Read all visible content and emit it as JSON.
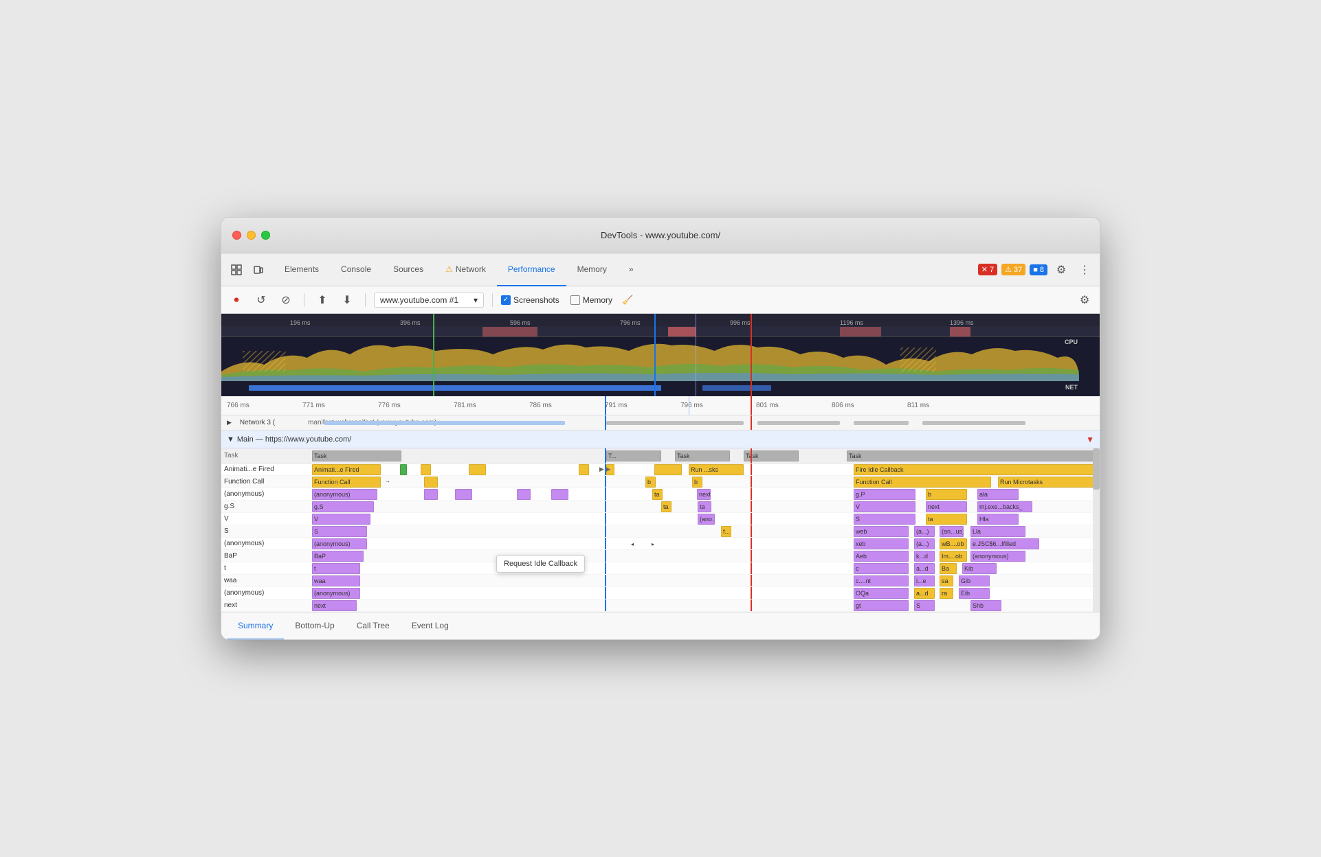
{
  "window": {
    "title": "DevTools - www.youtube.com/"
  },
  "tabs": {
    "items": [
      {
        "label": "Elements",
        "active": false,
        "warn": false
      },
      {
        "label": "Console",
        "active": false,
        "warn": false
      },
      {
        "label": "Sources",
        "active": false,
        "warn": false
      },
      {
        "label": "Network",
        "active": false,
        "warn": true
      },
      {
        "label": "Performance",
        "active": true,
        "warn": false
      },
      {
        "label": "Memory",
        "active": false,
        "warn": false
      }
    ],
    "more": "»",
    "badges": {
      "error": {
        "icon": "✕",
        "count": "7"
      },
      "warn": {
        "icon": "⚠",
        "count": "37"
      },
      "blue": {
        "icon": "■",
        "count": "8"
      }
    }
  },
  "toolbar": {
    "record": "⏺",
    "reload": "↺",
    "clear": "⊘",
    "upload": "⬆",
    "download": "⬇",
    "url": "www.youtube.com #1",
    "screenshots_label": "Screenshots",
    "memory_label": "Memory",
    "clean_icon": "🧹"
  },
  "ruler": {
    "ticks": [
      "196 ms",
      "396 ms",
      "596 ms",
      "796 ms",
      "996 ms",
      "1196 ms",
      "1396 ms"
    ]
  },
  "zoom_ruler": {
    "ticks": [
      "766 ms",
      "771 ms",
      "776 ms",
      "781 ms",
      "786 ms",
      "791 ms",
      "796 ms",
      "801 ms",
      "806 ms",
      "811 ms"
    ]
  },
  "network_row": {
    "label": "Network 3 (",
    "detail": "manifest.webmanifest (www.youtube.com)"
  },
  "main_section": {
    "label": "Main — https://www.youtube.com/",
    "expanded": true
  },
  "flame_tasks": {
    "header_tasks": [
      "Task",
      "T...",
      "Task",
      "Task",
      "Task"
    ],
    "rows": [
      {
        "label": "Animati...e Fired",
        "color": "c-yellow"
      },
      {
        "label": "Function Call",
        "color": "c-yellow"
      },
      {
        "label": "(anonymous)",
        "color": "c-purple"
      },
      {
        "label": "g.S",
        "color": "c-purple"
      },
      {
        "label": "V",
        "color": "c-purple"
      },
      {
        "label": "S",
        "color": "c-purple"
      },
      {
        "label": "(anonymous)",
        "color": "c-purple"
      },
      {
        "label": "BaP",
        "color": "c-purple"
      },
      {
        "label": "t",
        "color": "c-purple"
      },
      {
        "label": "waa",
        "color": "c-purple"
      },
      {
        "label": "(anonymous)",
        "color": "c-purple"
      },
      {
        "label": "next",
        "color": "c-purple"
      }
    ],
    "mid_col": {
      "blocks": [
        "b",
        "ta",
        "Run ...sks",
        "b",
        "next",
        "ta",
        "(ano...us)",
        "f..."
      ]
    },
    "right_col": {
      "title": "Fire Idle Callback",
      "blocks": [
        {
          "label": "Function Call",
          "sub": [
            "g.P",
            "V",
            "S",
            "web",
            "xeb",
            "Aeb",
            "c",
            "c....nt",
            "OQa",
            "gt"
          ]
        },
        {
          "label": "Run Microtasks",
          "sub": [
            "b",
            "next",
            "ta",
            "(a...)",
            "(a...)",
            "k...d",
            "a...d",
            "i...e",
            "a...d",
            "S"
          ]
        }
      ]
    }
  },
  "tooltip": {
    "text": "Request Idle Callback"
  },
  "right_labels": {
    "col1": [
      "g.P",
      "V",
      "S",
      "web",
      "xeb",
      "Aeb",
      "c",
      "c....nt",
      "OQa",
      "gt"
    ],
    "col2": [
      "b",
      "next",
      "ta",
      "(a...)",
      "(a...)",
      "k...d",
      "a...d",
      "i...e",
      "a...d",
      "S"
    ],
    "col3": [
      "ala",
      "mj.exe...backs_",
      "Hla",
      "Lla",
      "e.JSC$6...Ifilled",
      "(anonymous)",
      "Kib",
      "Gib",
      "Eib",
      "Shb"
    ]
  },
  "bottom_tabs": {
    "items": [
      "Summary",
      "Bottom-Up",
      "Call Tree",
      "Event Log"
    ],
    "active": "Summary"
  },
  "labels": {
    "cpu": "CPU",
    "net": "NET",
    "chevron_right": "▶",
    "chevron_down": "▼",
    "triangle": "▸"
  }
}
